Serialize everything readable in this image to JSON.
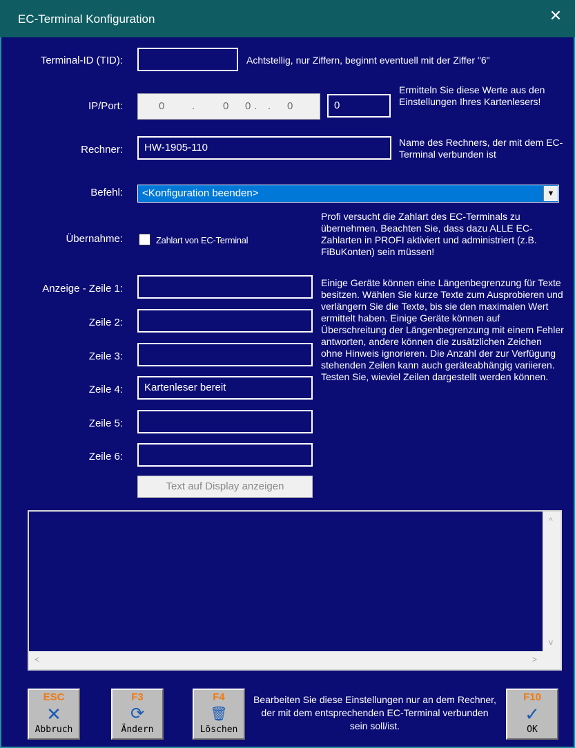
{
  "window": {
    "title": "EC-Terminal Konfiguration",
    "close_glyph": "✕"
  },
  "tid": {
    "label": "Terminal-ID (TID):",
    "value": "",
    "hint": "Achtstellig, nur Ziffern, beginnt eventuell mit der Ziffer \"6\""
  },
  "ip": {
    "label": "IP/Port:",
    "octets": [
      "0",
      "0",
      "0",
      "0"
    ],
    "dots": [
      ".",
      ".",
      "."
    ],
    "port": "0",
    "hint": "Ermitteln Sie diese Werte aus den Einstellungen Ihres Kartenlesers!"
  },
  "rechner": {
    "label": "Rechner:",
    "value": "HW-1905-110",
    "hint": "Name des Rechners, der mit dem EC-Terminal verbunden ist"
  },
  "befehl": {
    "label": "Befehl:",
    "value": "<Konfiguration beenden>",
    "arrow": "▼"
  },
  "uebernahme": {
    "label": "Übernahme:",
    "checkbox_label": "Zahlart von EC-Terminal",
    "checked": false,
    "hint": "Profi versucht die Zahlart des EC-Terminals zu übernehmen. Beachten Sie, dass dazu ALLE EC-Zahlarten in PROFI aktiviert und administriert (z.B. FiBuKonten) sein müssen!"
  },
  "display": {
    "lines": [
      {
        "label": "Anzeige - Zeile 1:",
        "value": ""
      },
      {
        "label": "Zeile 2:",
        "value": ""
      },
      {
        "label": "Zeile 3:",
        "value": ""
      },
      {
        "label": "Zeile 4:",
        "value": "Kartenleser bereit"
      },
      {
        "label": "Zeile 5:",
        "value": ""
      },
      {
        "label": "Zeile 6:",
        "value": ""
      }
    ],
    "hint": "Einige Geräte können eine Längenbegrenzung für Texte besitzen. Wählen Sie kurze Texte zum Ausprobieren und verlängern Sie die Texte, bis sie den maximalen Wert ermittelt haben. Einige Geräte können auf Überschreitung der Längenbegrenzung mit einem Fehler antworten, andere können die zusätzlichen Zeichen ohne Hinweis ignorieren. Die Anzahl der zur Verfügung stehenden Zeilen kann auch geräteabhängig variieren. Testen Sie, wieviel Zeilen dargestellt werden können.",
    "show_button": "Text auf Display anzeigen"
  },
  "log": {
    "text": ""
  },
  "scroll": {
    "up": "^",
    "down": "v",
    "left": "<",
    "right": ">"
  },
  "footer": {
    "buttons": [
      {
        "key": "ESC",
        "label": "Abbruch",
        "icon": "x-icon",
        "glyph": "✕"
      },
      {
        "key": "F3",
        "label": "Ändern",
        "icon": "refresh-icon",
        "glyph": "⟳"
      },
      {
        "key": "F4",
        "label": "Löschen",
        "icon": "trash-icon",
        "glyph": "🗑"
      },
      {
        "key": "F10",
        "label": "OK",
        "icon": "check-icon",
        "glyph": "✓"
      }
    ],
    "note": "Bearbeiten Sie diese Einstellungen nur an dem Rechner, der mit dem entsprechenden EC-Terminal verbunden sein soll/ist."
  }
}
